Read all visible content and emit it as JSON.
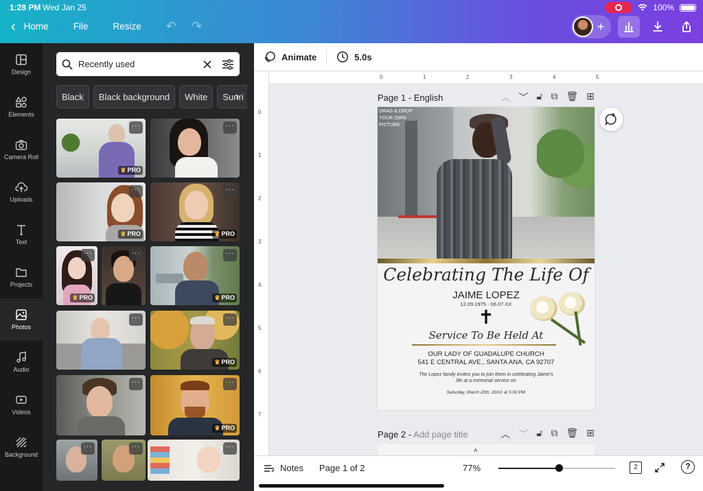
{
  "status": {
    "time": "1:28 PM",
    "date": "Wed Jan 25",
    "battery": "100%"
  },
  "topnav": {
    "home": "Home",
    "file": "File",
    "resize": "Resize"
  },
  "rail": [
    {
      "label": "Design"
    },
    {
      "label": "Elements"
    },
    {
      "label": "Camera Roll"
    },
    {
      "label": "Uploads"
    },
    {
      "label": "Text"
    },
    {
      "label": "Projects"
    },
    {
      "label": "Photos"
    },
    {
      "label": "Audio"
    },
    {
      "label": "Videos"
    },
    {
      "label": "Background"
    }
  ],
  "search": {
    "value": "Recently used"
  },
  "chips": [
    "Black",
    "Black background",
    "White",
    "Sunri"
  ],
  "photos": {
    "pro_label": "PRO",
    "more_label": "···"
  },
  "editor": {
    "animate": "Animate",
    "duration": "5.0s"
  },
  "ruler": {
    "top": [
      "0",
      "1",
      "2",
      "3",
      "4",
      "5"
    ],
    "left": [
      "0",
      "1",
      "2",
      "3",
      "4",
      "5",
      "6",
      "7"
    ]
  },
  "page1": {
    "label": "Page 1 - English"
  },
  "page2": {
    "label": "Page 2 - ",
    "placeholder": "Add page title"
  },
  "design": {
    "drag_drop": "DRAG & DROP YOUR OWN PICTURE",
    "headline": "Celebrating The Life Of",
    "name": "JAIME LOPEZ",
    "dates": "12.09.1975 - 06.07.XX",
    "cross": "✝",
    "service": "Service To Be Held At",
    "venue": "OUR LADY OF GUADALUPE CHURCH",
    "address": "541 E CENTRAL AVE., SANTA ANA, CA 92707",
    "invite_1": "The Lopez family invites you to join them in celebrating Jaime's",
    "invite_2": "life at a memorial service on",
    "datetime": "Saturday, March 20th, 20XX at 5:00 PM"
  },
  "bottom": {
    "notes": "Notes",
    "page_count": "Page 1 of 2",
    "zoom": "77%",
    "zoom_fraction": 0.52,
    "pages_badge": "2"
  }
}
